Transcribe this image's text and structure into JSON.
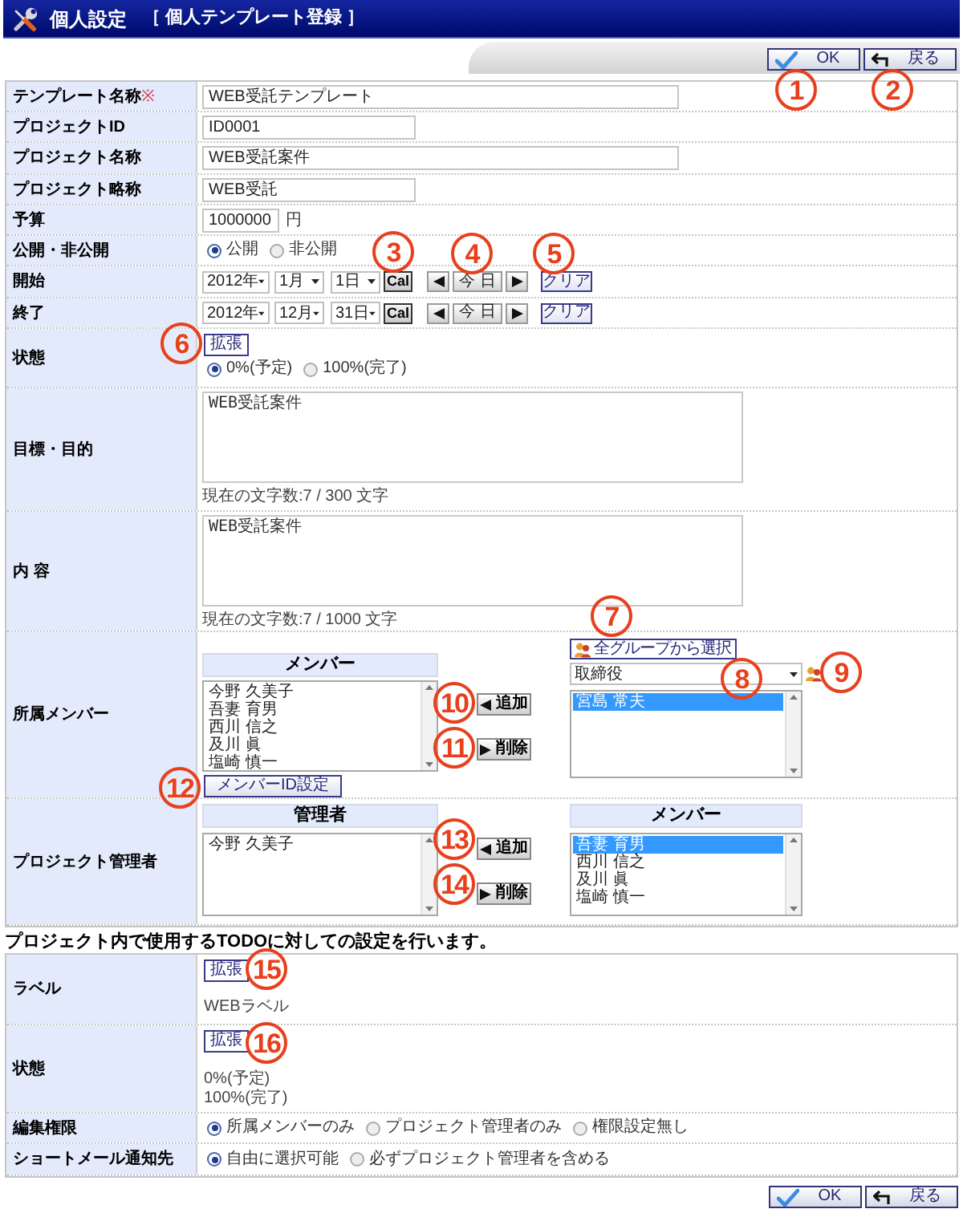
{
  "header": {
    "title": "個人設定",
    "subtitle": "［ 個人テンプレート登録 ］"
  },
  "top_actions": [
    {
      "kind": "ok",
      "label": "OK"
    },
    {
      "kind": "back",
      "label": "戻る"
    }
  ],
  "project_form": {
    "template_name": {
      "label": "テンプレート名称",
      "required_mark": "※",
      "value": "WEB受託テンプレート"
    },
    "project_id": {
      "label": "プロジェクトID",
      "value": "ID0001"
    },
    "project_name": {
      "label": "プロジェクト名称",
      "value": "WEB受託案件"
    },
    "project_short_name": {
      "label": "プロジェクト略称",
      "value": "WEB受託"
    },
    "budget": {
      "label": "予算",
      "value": "1000000",
      "unit": "円"
    },
    "visibility": {
      "label": "公開・非公開",
      "options": [
        {
          "label": "公開",
          "selected": true
        },
        {
          "label": "非公開",
          "selected": false
        }
      ]
    },
    "start": {
      "label": "開始",
      "year": "2012年",
      "month": "1月",
      "day": "1日",
      "calendar_button": "Cal",
      "today_button": "今 日",
      "clear_button": "クリア"
    },
    "end": {
      "label": "終了",
      "year": "2012年",
      "month": "12月",
      "day": "31日",
      "calendar_button": "Cal",
      "today_button": "今 日",
      "clear_button": "クリア"
    },
    "status": {
      "label": "状態",
      "expand_button": "拡張",
      "options": [
        {
          "label": "0%(予定)",
          "selected": true
        },
        {
          "label": "100%(完了)",
          "selected": false
        }
      ]
    },
    "goal": {
      "label": "目標・目的",
      "value": "WEB受託案件",
      "counter": "現在の文字数:7 / 300 文字"
    },
    "content": {
      "label": "内 容",
      "value": "WEB受託案件",
      "counter": "現在の文字数:7 / 1000 文字"
    },
    "members": {
      "label": "所属メンバー",
      "list_header": "メンバー",
      "list": [
        {
          "name": "今野 久美子",
          "selected": false
        },
        {
          "name": "吾妻 育男",
          "selected": false
        },
        {
          "name": "西川 信之",
          "selected": false
        },
        {
          "name": "及川 眞",
          "selected": false
        },
        {
          "name": "塩崎 慎一",
          "selected": false
        }
      ],
      "add_button": "追加",
      "remove_button": "削除",
      "id_button": "メンバーID設定",
      "group_button": "全グループから選択",
      "group_select": "取締役",
      "candidates": [
        {
          "name": "宮島 常夫",
          "selected": true
        }
      ]
    },
    "managers": {
      "label": "プロジェクト管理者",
      "managers_header": "管理者",
      "managers": [
        {
          "name": "今野 久美子",
          "selected": false
        }
      ],
      "add_button": "追加",
      "remove_button": "削除",
      "members_header": "メンバー",
      "members": [
        {
          "name": "吾妻 育男",
          "selected": true
        },
        {
          "name": "西川 信之",
          "selected": false
        },
        {
          "name": "及川 眞",
          "selected": false
        },
        {
          "name": "塩崎 慎一",
          "selected": false
        }
      ]
    }
  },
  "todo_note": "プロジェクト内で使用するTODOに対しての設定を行います。",
  "todo_form": {
    "label_row": {
      "label": "ラベル",
      "expand_button": "拡張",
      "values": [
        "WEBラベル"
      ]
    },
    "status_row": {
      "label": "状態",
      "expand_button": "拡張",
      "values": [
        "0%(予定)",
        "100%(完了)"
      ]
    },
    "edit_permission": {
      "label": "編集権限",
      "options": [
        {
          "label": "所属メンバーのみ",
          "selected": true
        },
        {
          "label": "プロジェクト管理者のみ",
          "selected": false
        },
        {
          "label": "権限設定無し",
          "selected": false
        }
      ]
    },
    "mail_notify": {
      "label": "ショートメール通知先",
      "options": [
        {
          "label": "自由に選択可能",
          "selected": true
        },
        {
          "label": "必ずプロジェクト管理者を含める",
          "selected": false
        }
      ]
    }
  },
  "bottom_actions": [
    {
      "kind": "ok",
      "label": "OK"
    },
    {
      "kind": "back",
      "label": "戻る"
    }
  ],
  "callouts": [
    "1",
    "2",
    "3",
    "4",
    "5",
    "6",
    "7",
    "8",
    "9",
    "10",
    "11",
    "12",
    "13",
    "14",
    "15",
    "16"
  ]
}
